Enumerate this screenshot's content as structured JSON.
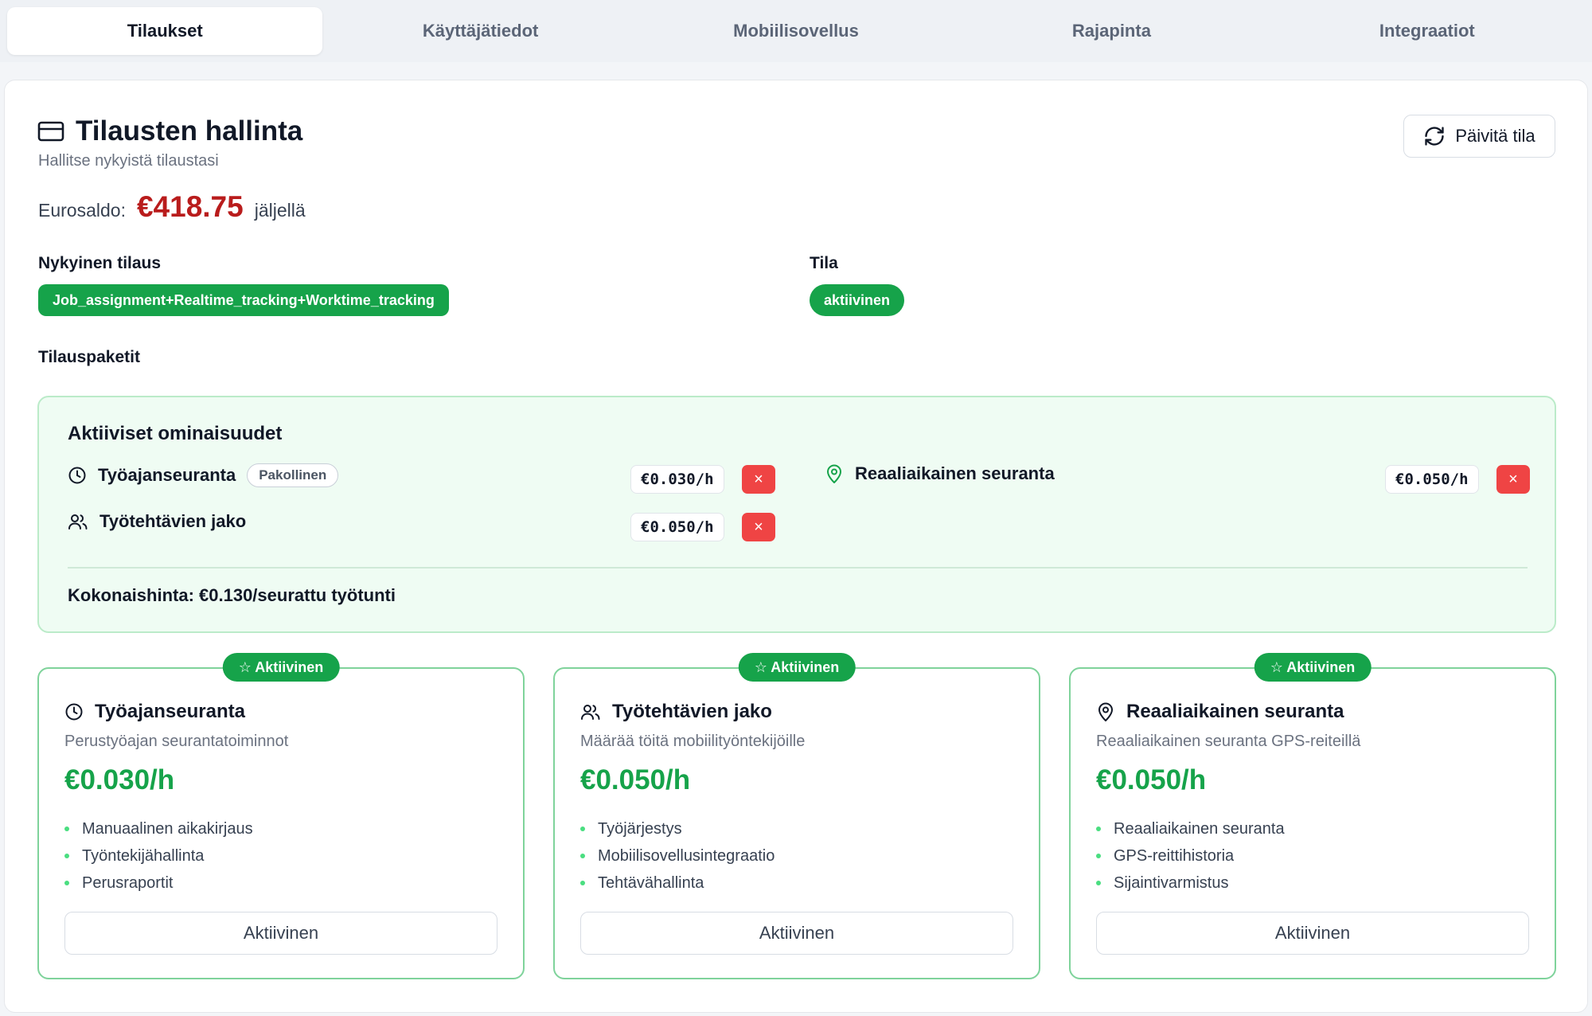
{
  "tabs": [
    {
      "label": "Tilaukset",
      "active": true
    },
    {
      "label": "Käyttäjätiedot",
      "active": false
    },
    {
      "label": "Mobiilisovellus",
      "active": false
    },
    {
      "label": "Rajapinta",
      "active": false
    },
    {
      "label": "Integraatiot",
      "active": false
    }
  ],
  "header": {
    "title": "Tilausten hallinta",
    "subtitle": "Hallitse nykyistä tilaustasi",
    "refresh_label": "Päivitä tila"
  },
  "balance": {
    "label": "Eurosaldo:",
    "value": "€418.75",
    "suffix": "jäljellä"
  },
  "current_plan": {
    "label": "Nykyinen tilaus",
    "value": "Job_assignment+Realtime_tracking+Worktime_tracking"
  },
  "status": {
    "label": "Tila",
    "value": "aktiivinen"
  },
  "packages_label": "Tilauspaketit",
  "active_features": {
    "title": "Aktiiviset ominaisuudet",
    "items": [
      {
        "name": "Työajanseuranta",
        "badge": "Pakollinen",
        "price": "€0.030/h",
        "icon": "clock-icon"
      },
      {
        "name": "Reaaliaikainen seuranta",
        "price": "€0.050/h",
        "icon": "map-pin-icon"
      },
      {
        "name": "Työtehtävien jako",
        "price": "€0.050/h",
        "icon": "users-icon"
      }
    ],
    "remove_symbol": "×",
    "total": "Kokonaishinta: €0.130/seurattu työtunti"
  },
  "cards": [
    {
      "badge": "☆ Aktiivinen",
      "title": "Työajanseuranta",
      "icon": "clock-icon",
      "description": "Perustyöajan seurantatoiminnot",
      "price": "€0.030/h",
      "features": [
        "Manuaalinen aikakirjaus",
        "Työntekijähallinta",
        "Perusraportit"
      ],
      "button": "Aktiivinen"
    },
    {
      "badge": "☆ Aktiivinen",
      "title": "Työtehtävien jako",
      "icon": "users-icon",
      "description": "Määrää töitä mobiilityöntekijöille",
      "price": "€0.050/h",
      "features": [
        "Työjärjestys",
        "Mobiilisovellusintegraatio",
        "Tehtävähallinta"
      ],
      "button": "Aktiivinen"
    },
    {
      "badge": "☆ Aktiivinen",
      "title": "Reaaliaikainen seuranta",
      "icon": "map-pin-icon",
      "description": "Reaaliaikainen seuranta GPS-reiteillä",
      "price": "€0.050/h",
      "features": [
        "Reaaliaikainen seuranta",
        "GPS-reittihistoria",
        "Sijaintivarmistus"
      ],
      "button": "Aktiivinen"
    }
  ],
  "colors": {
    "accent_green": "#16a34a",
    "balance_red": "#b91c1c",
    "remove_red": "#ef4444"
  }
}
